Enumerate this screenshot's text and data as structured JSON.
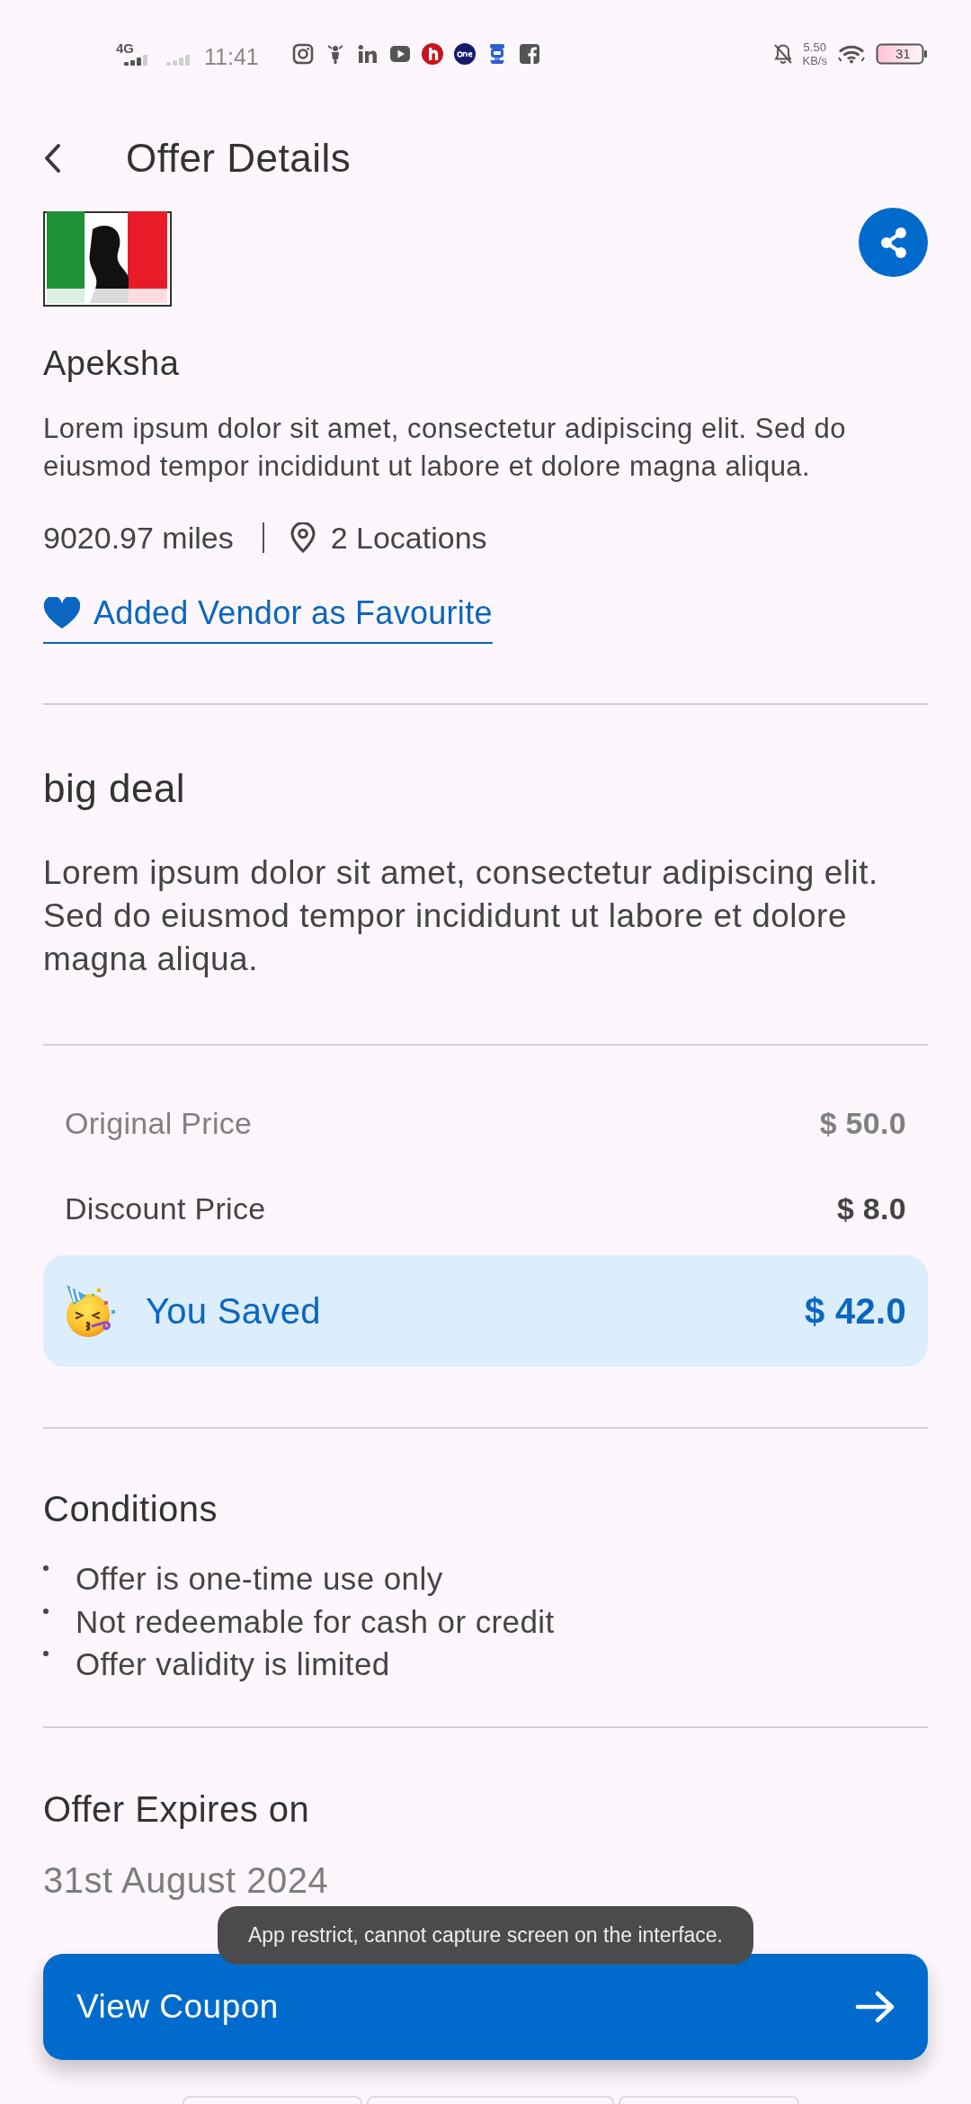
{
  "status_bar": {
    "network": "4G",
    "time": "11:41",
    "speed": "5.50",
    "speed_unit": "KB/s",
    "battery": "31"
  },
  "header": {
    "title": "Offer Details"
  },
  "vendor": {
    "name": "Apeksha",
    "description": "Lorem ipsum dolor sit amet, consectetur adipiscing elit. Sed do eiusmod tempor incididunt ut labore et dolore magna aliqua.",
    "distance": "9020.97 miles",
    "locations": "2 Locations",
    "favourite": {
      "label": "Added Vendor as Favourite",
      "on": true
    }
  },
  "offer": {
    "title": "big deal",
    "description": "Lorem ipsum dolor sit amet, consectetur adipiscing elit. Sed do eiusmod tempor incididunt ut labore et dolore magna aliqua."
  },
  "prices": [
    {
      "kind": "original",
      "label": "Original Price",
      "value": "$ 50.0"
    },
    {
      "kind": "discount",
      "label": "Discount Price",
      "value": "$ 8.0"
    },
    {
      "kind": "saved",
      "label": "You Saved",
      "value": "$ 42.0"
    }
  ],
  "conditions": {
    "title": "Conditions",
    "items": [
      "Offer is one-time use only",
      "Not redeemable for cash or credit",
      "Offer validity is limited"
    ]
  },
  "expiry": {
    "title": "Offer Expires on",
    "date": "31st August 2024"
  },
  "toast": {
    "text": "App restrict, cannot capture screen on the interface."
  },
  "action": {
    "label": "View Coupon"
  }
}
